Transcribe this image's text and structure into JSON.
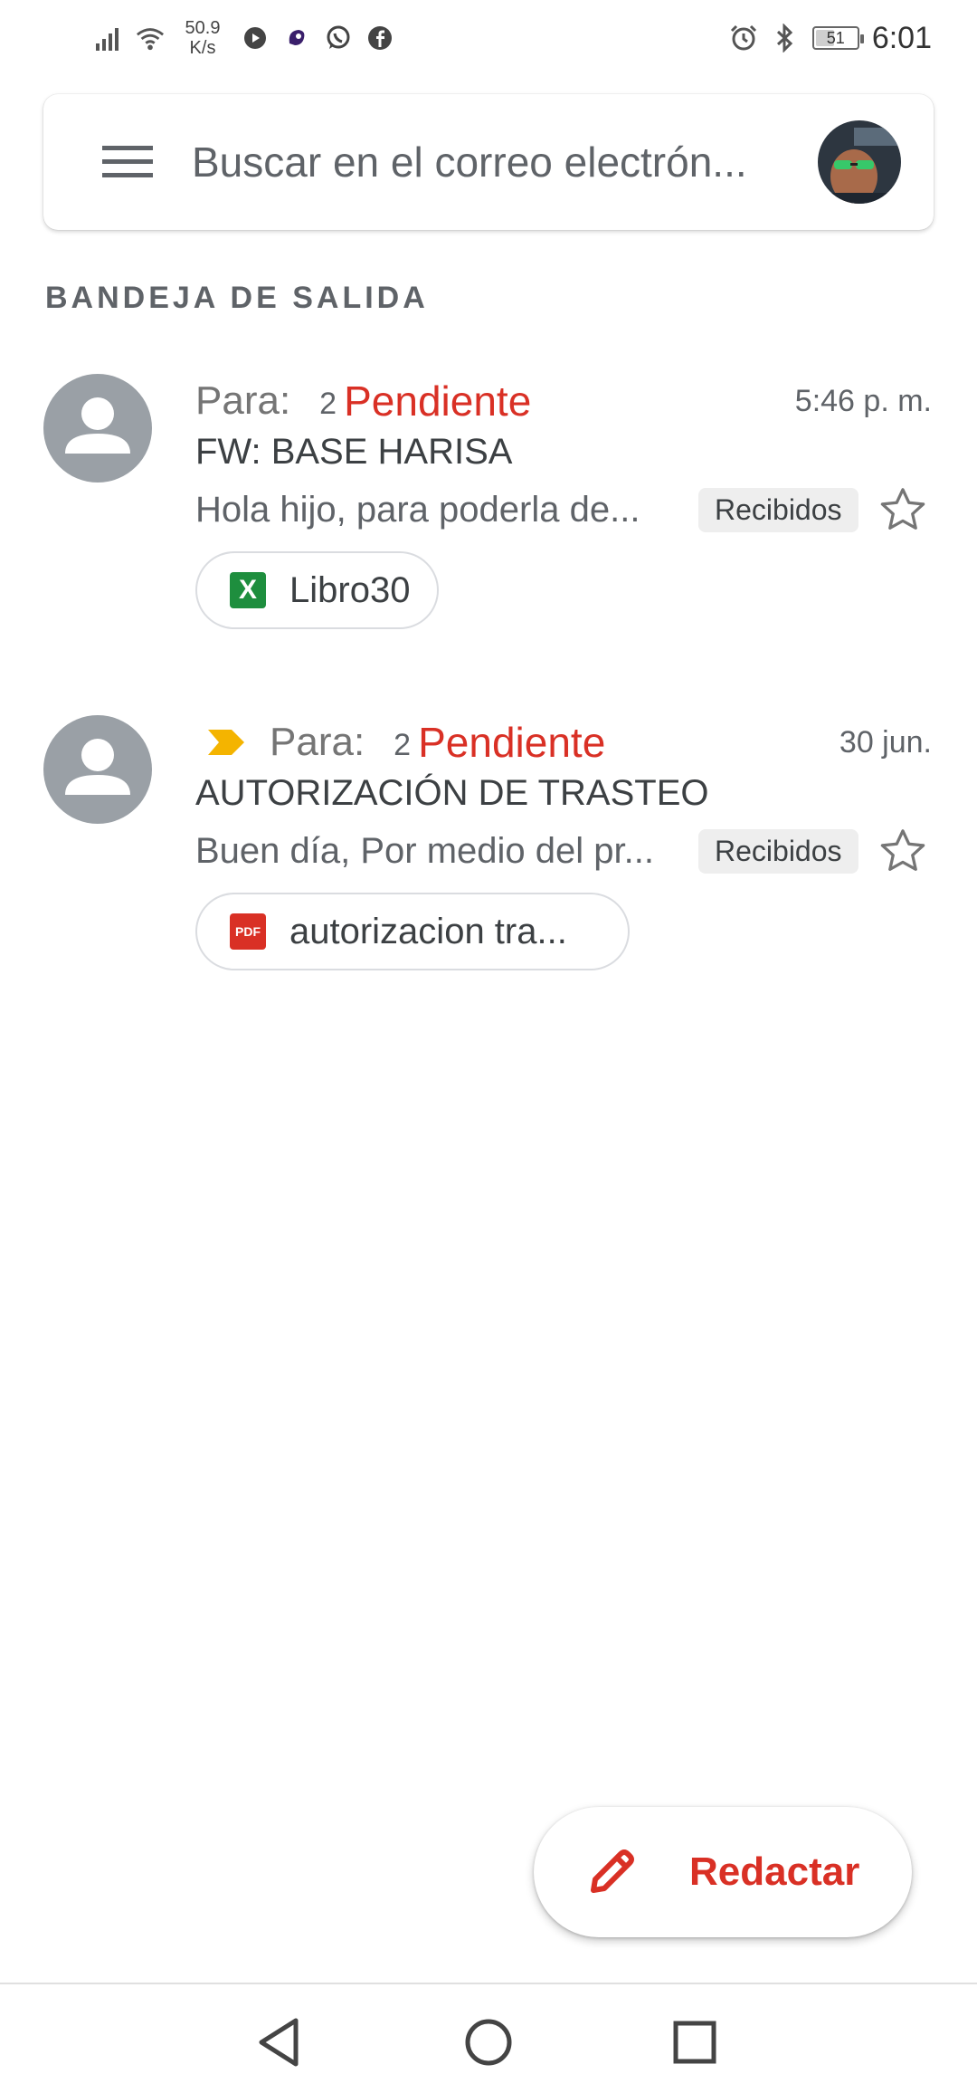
{
  "status_bar": {
    "speed_value": "50.9",
    "speed_unit": "K/s",
    "time": "6:01",
    "battery": "51",
    "battery_level_percent": 51,
    "icons": [
      "signal-icon",
      "wifi-icon",
      "media-icon",
      "app-icon",
      "whatsapp-icon",
      "facebook-icon",
      "alarm-icon",
      "bluetooth-icon",
      "battery-icon"
    ]
  },
  "search": {
    "placeholder": "Buscar en el correo electrón..."
  },
  "section_title": "BANDEJA DE SALIDA",
  "emails": [
    {
      "para": "Para:",
      "count": "2",
      "status": "Pendiente",
      "date": "5:46 p. m.",
      "subject": "FW: BASE HARISA",
      "snippet": "Hola hijo, para poderla de...",
      "label": "Recibidos",
      "attachment": "Libro30",
      "attachment_type": "xls",
      "important": false
    },
    {
      "para": "Para:",
      "count": "2",
      "status": "Pendiente",
      "date": "30 jun.",
      "subject": "AUTORIZACIÓN DE TRASTEO",
      "snippet": "Buen día, Por medio del pr...",
      "label": "Recibidos",
      "attachment": "autorizacion tra...",
      "attachment_type": "pdf",
      "important": true
    }
  ],
  "compose": {
    "label": "Redactar"
  },
  "colors": {
    "accent_red": "#d93025",
    "importance_yellow": "#f4b400",
    "xls_green": "#1e8e3e",
    "avatar_gray": "#9aa0a6"
  }
}
